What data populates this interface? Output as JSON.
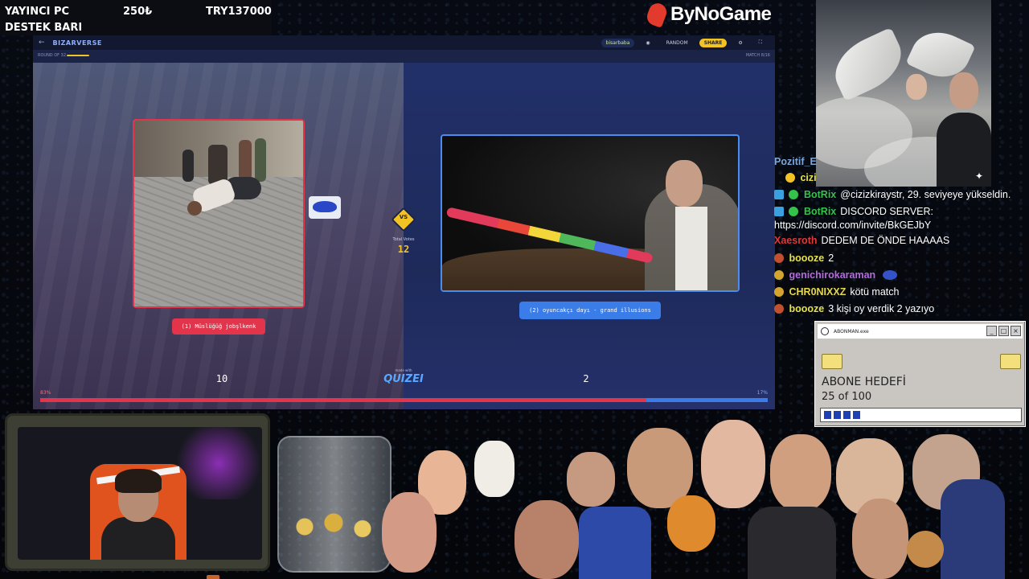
{
  "donation": {
    "label": "YAYINCI PC",
    "amount": "250₺",
    "goal": "TRY137000",
    "label2": "DESTEK BARI"
  },
  "brand": {
    "name": "ByNoGame",
    "color": "#e23a2c"
  },
  "game": {
    "title": "BIZARVERSE",
    "back_icon": "arrow-left-icon",
    "user_chip": "bisarbaba",
    "random_label": "RANDOM",
    "share_label": "SHARE",
    "round_label": "ROUND OF 32",
    "match_label": "MATCH 8/16",
    "left_option": "(1) Müslüğüğ jobşlkenk",
    "right_option": "(2) oyuncakçı dayı - grand illusions",
    "vs_label": "VS",
    "total_votes_label": "Total Votes",
    "total_votes": "12",
    "left_votes": "10",
    "right_votes": "2",
    "made_with": "made with",
    "maker": "QUIZEI",
    "left_pct_label": "83%",
    "right_pct_label": "17%",
    "left_share": 0.833,
    "colors": {
      "left": "#e2354c",
      "right": "#3a7de8",
      "accent": "#f2c322"
    }
  },
  "chat": {
    "messages": [
      {
        "user": "Pozitif_E",
        "text": "",
        "color": "#7fa6d8"
      },
      {
        "user": "cizi",
        "text": "",
        "color": "#e8e34a"
      },
      {
        "user": "BotRix",
        "text": "@cizizkiraystr, 29. seviyeye yükseldin.",
        "color": "#35c24a"
      },
      {
        "user": "BotRix",
        "text": "DISCORD SERVER:",
        "color": "#35c24a"
      },
      {
        "user": "",
        "text": "https://discord.com/invite/BkGEJbY",
        "color": "#fff"
      },
      {
        "user": "Xaesroth",
        "text": "DEDEM DE ÖNDE HAAAAS",
        "color": "#e0393a"
      },
      {
        "user": "boooze",
        "text": "2",
        "color": "#e5e24a"
      },
      {
        "user": "genichirokaraman",
        "text": "",
        "color": "#b56be0"
      },
      {
        "user": "CHR0NIXXZ",
        "text": "kötü match",
        "color": "#e6d84a"
      },
      {
        "user": "boooze",
        "text": "3 kişi oy verdik 2 yazıyo",
        "color": "#e5e24a"
      }
    ]
  },
  "goal_window": {
    "title": "ABONMAN.exe",
    "heading": "ABONE HEDEFİ",
    "count_text": "25 of 100",
    "progress": 0.25,
    "buttons": [
      "_",
      "□",
      "×"
    ]
  }
}
